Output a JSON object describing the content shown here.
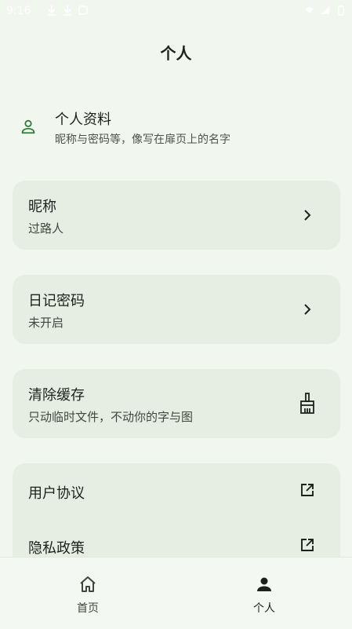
{
  "status_bar": {
    "time": "9:16"
  },
  "header": {
    "title": "个人"
  },
  "profile": {
    "title": "个人资料",
    "subtitle": "昵称与密码等，像写在扉页上的名字",
    "icon": "person-outline-icon"
  },
  "settings": {
    "nickname": {
      "title": "昵称",
      "value": "过路人"
    },
    "diary_password": {
      "title": "日记密码",
      "value": "未开启"
    },
    "clear_cache": {
      "title": "清除缓存",
      "value": "只动临时文件，不动你的字与图"
    }
  },
  "links": {
    "user_agreement": "用户协议",
    "privacy_policy": "隐私政策"
  },
  "bottom_nav": {
    "home": "首页",
    "profile": "个人"
  },
  "colors": {
    "background": "#f1f6ef",
    "card": "#e6eee3",
    "accent": "#2e7d3b",
    "text": "#1d211c"
  }
}
